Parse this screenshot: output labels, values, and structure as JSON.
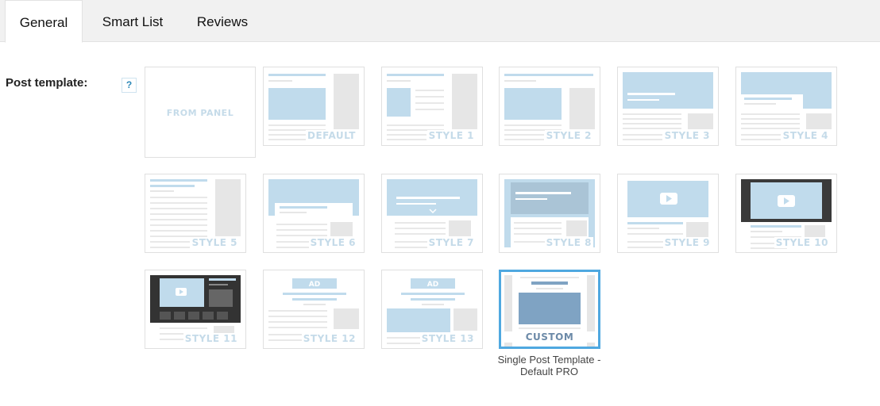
{
  "tabs": [
    {
      "label": "General"
    },
    {
      "label": "Smart List"
    },
    {
      "label": "Reviews"
    }
  ],
  "field": {
    "label": "Post template:",
    "help": "?"
  },
  "templates": [
    {
      "label": "FROM PANEL"
    },
    {
      "label": "DEFAULT"
    },
    {
      "label": "STYLE 1"
    },
    {
      "label": "STYLE 2"
    },
    {
      "label": "STYLE 3"
    },
    {
      "label": "STYLE 4"
    },
    {
      "label": "STYLE 5"
    },
    {
      "label": "STYLE 6"
    },
    {
      "label": "STYLE 7"
    },
    {
      "label": "STYLE 8"
    },
    {
      "label": "STYLE 9"
    },
    {
      "label": "STYLE 10"
    },
    {
      "label": "STYLE 11"
    },
    {
      "label": "STYLE 12"
    },
    {
      "label": "STYLE 13"
    },
    {
      "label": "CUSTOM",
      "selected": true
    }
  ],
  "ad_label": "AD",
  "selected_caption": "Single Post Template - Default PRO",
  "colors": {
    "accent": "#4fa8e0",
    "thumb_blue": "#c0dbec",
    "thumb_grey": "#e6e6e6",
    "thumb_line": "#e8e8e8"
  },
  "icons": [
    "help-icon",
    "play-icon"
  ]
}
